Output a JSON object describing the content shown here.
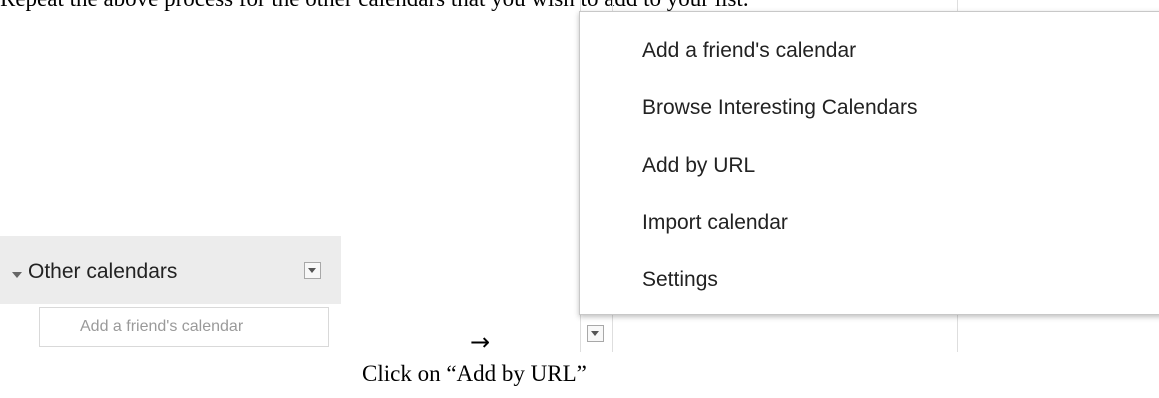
{
  "instruction_top": "Repeat the above process for the other calendars that you wish to add to your list.",
  "instruction_bottom": "Click on “Add by URL”",
  "arrow": "→",
  "sidebar": {
    "section_title": "Other calendars",
    "friend_input_placeholder": "Add a friend's calendar",
    "expand_icon": "triangle-down-icon",
    "menu_icon": "dropdown-caret-icon"
  },
  "menu": {
    "items": [
      {
        "label": "Add a friend's calendar"
      },
      {
        "label": "Browse Interesting Calendars"
      },
      {
        "label": "Add by URL"
      },
      {
        "label": "Import calendar"
      },
      {
        "label": "Settings"
      }
    ]
  },
  "colors": {
    "section_header_bg": "#ececec",
    "menu_border": "#c8c8c8",
    "text": "#222222",
    "placeholder": "#9a9a9a"
  }
}
